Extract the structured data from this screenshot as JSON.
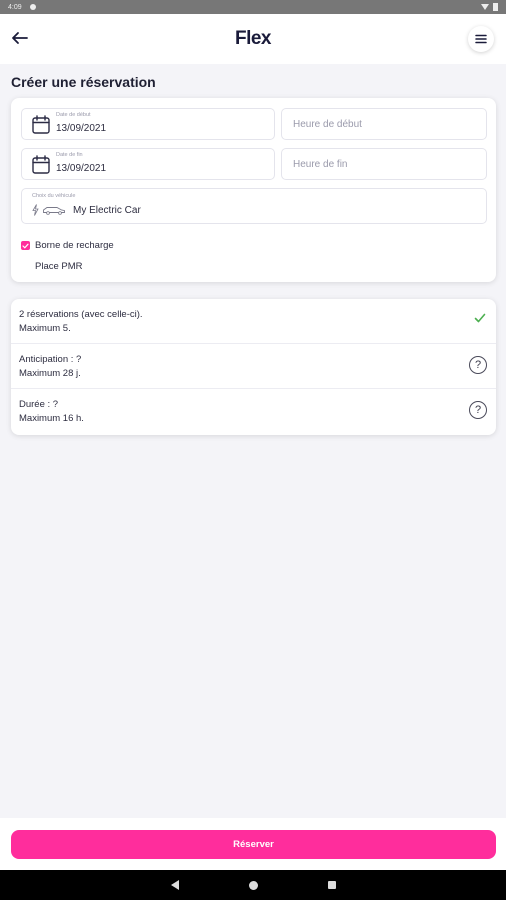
{
  "status_bar": {
    "time": "4:09"
  },
  "header": {
    "logo": "Flex"
  },
  "page": {
    "title": "Créer une réservation"
  },
  "form": {
    "start_date": {
      "label": "Date de début",
      "value": "13/09/2021"
    },
    "start_time": {
      "placeholder": "Heure de début"
    },
    "end_date": {
      "label": "Date de fin",
      "value": "13/09/2021"
    },
    "end_time": {
      "placeholder": "Heure de fin"
    },
    "vehicle": {
      "label": "Choix du véhicule",
      "value": "My Electric Car"
    },
    "options": [
      {
        "label": "Borne de recharge",
        "checked": true
      },
      {
        "label": "Place PMR",
        "checked": false
      }
    ]
  },
  "rules": [
    {
      "line1": "2 réservations (avec celle-ci).",
      "line2": "Maximum 5.",
      "icon": "check-icon"
    },
    {
      "line1": "Anticipation : ?",
      "line2": "Maximum 28 j.",
      "icon": "help-icon",
      "icon_text": "?"
    },
    {
      "line1": "Durée : ?",
      "line2": "Maximum 16 h.",
      "icon": "help-icon",
      "icon_text": "?"
    }
  ],
  "actions": {
    "reserve_label": "Réserver"
  },
  "colors": {
    "accent": "#ff2d9c",
    "success": "#4caf50"
  }
}
